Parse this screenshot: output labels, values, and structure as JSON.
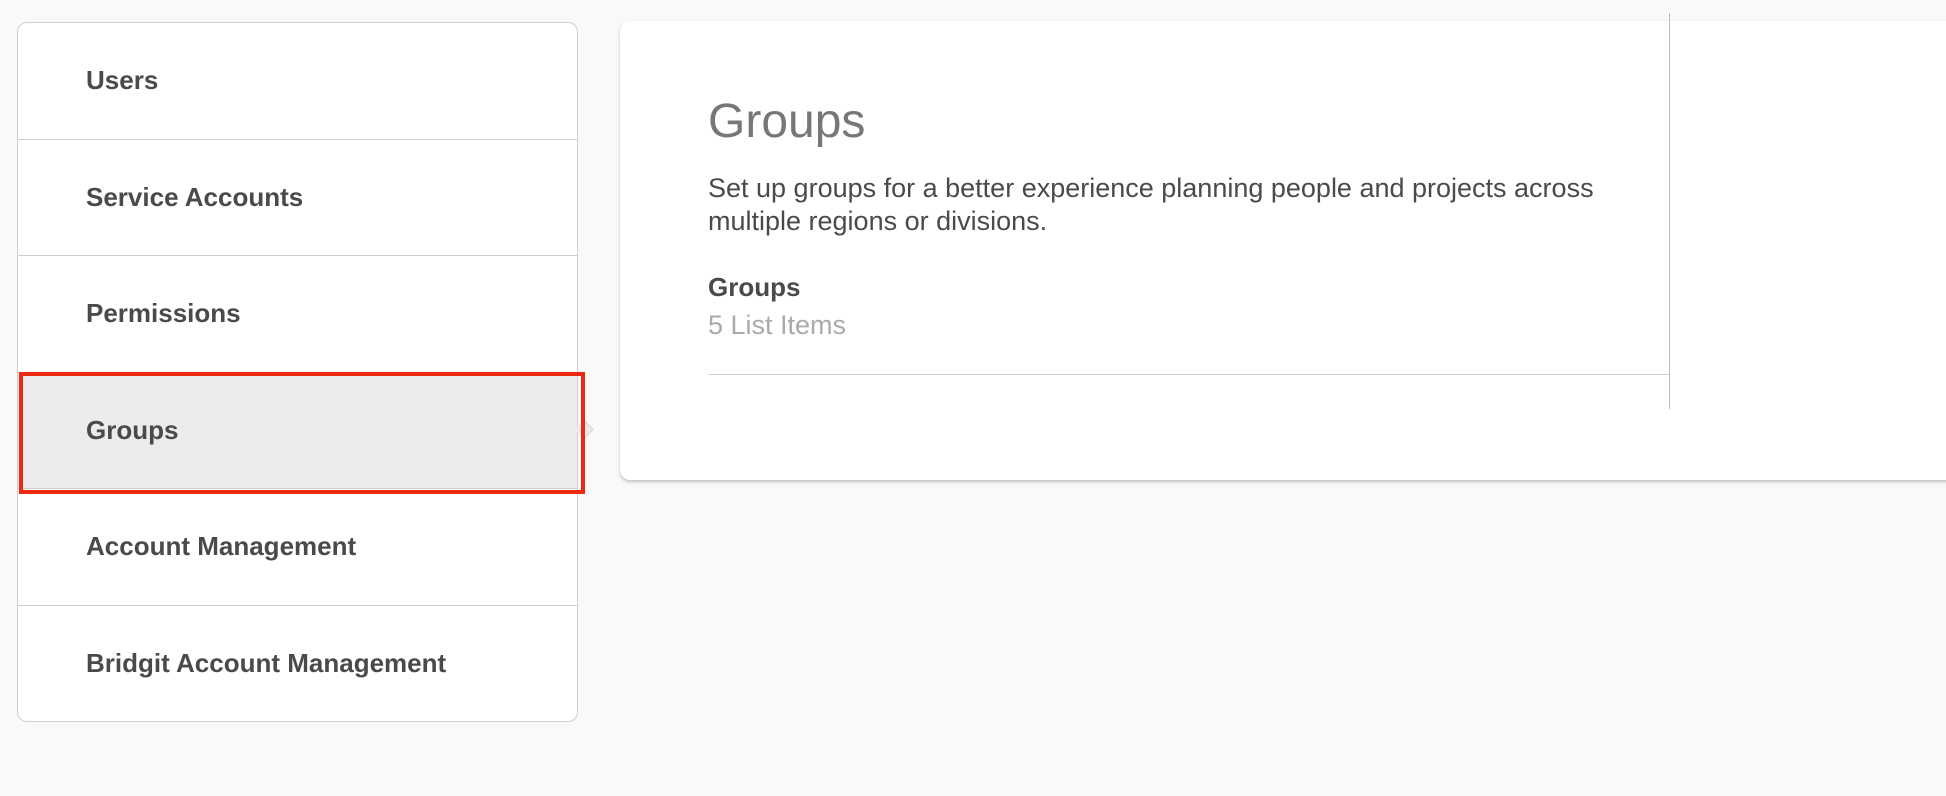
{
  "sidebar": {
    "items": [
      {
        "label": "Users",
        "active": false
      },
      {
        "label": "Service Accounts",
        "active": false
      },
      {
        "label": "Permissions",
        "active": false
      },
      {
        "label": "Groups",
        "active": true
      },
      {
        "label": "Account Management",
        "active": false
      },
      {
        "label": "Bridgit Account Management",
        "active": false
      }
    ]
  },
  "main": {
    "title": "Groups",
    "description": "Set up groups for a better experience planning people and projects across multiple regions or divisions.",
    "section": {
      "label": "Groups",
      "count_text": "5 List Items"
    }
  },
  "colors": {
    "background": "#f9f9f9",
    "active_item": "#ececec",
    "highlight": "#ec2a12",
    "title": "#777777",
    "muted": "#aaaaaa"
  }
}
